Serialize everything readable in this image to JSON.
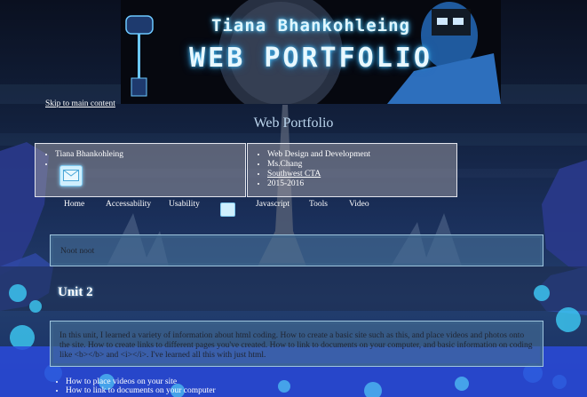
{
  "banner": {
    "name_line": "Tiana Bhankohleing",
    "title_line": "WEB PORTFOLIO"
  },
  "skip_link": "Skip to main content",
  "site_title": "Web Portfolio",
  "info_left": {
    "name": "Tiana Bhankohleing",
    "mail_icon": "envelope-icon"
  },
  "info_right": {
    "course": "Web Design and Development",
    "teacher": "Ms.Chang",
    "school": "Southwest CTA",
    "years": "2015-2016"
  },
  "nav": {
    "items": [
      "Home",
      "Accessability",
      "Usability",
      "Javascript",
      "Tools",
      "Video"
    ]
  },
  "note_panel": {
    "text": "Noot noot"
  },
  "unit": {
    "heading": "Unit 2",
    "body": "In this unit, I learned a variety of information about html coding. How to create a basic site such as this, and place videos and photos onto the site. How to create links to different pages you've created. How to link to documents on your computer, and basic information on coding like <b></b> and <i></i>. I've learned all this with just html."
  },
  "unit_list": [
    "How to place videos on your site",
    "How to link to documents on your computer"
  ],
  "colors": {
    "panel_bg": "#46739a",
    "panel_border": "#9fc6de",
    "nav_text": "#ffffff",
    "title_color": "#bcd6ee"
  }
}
